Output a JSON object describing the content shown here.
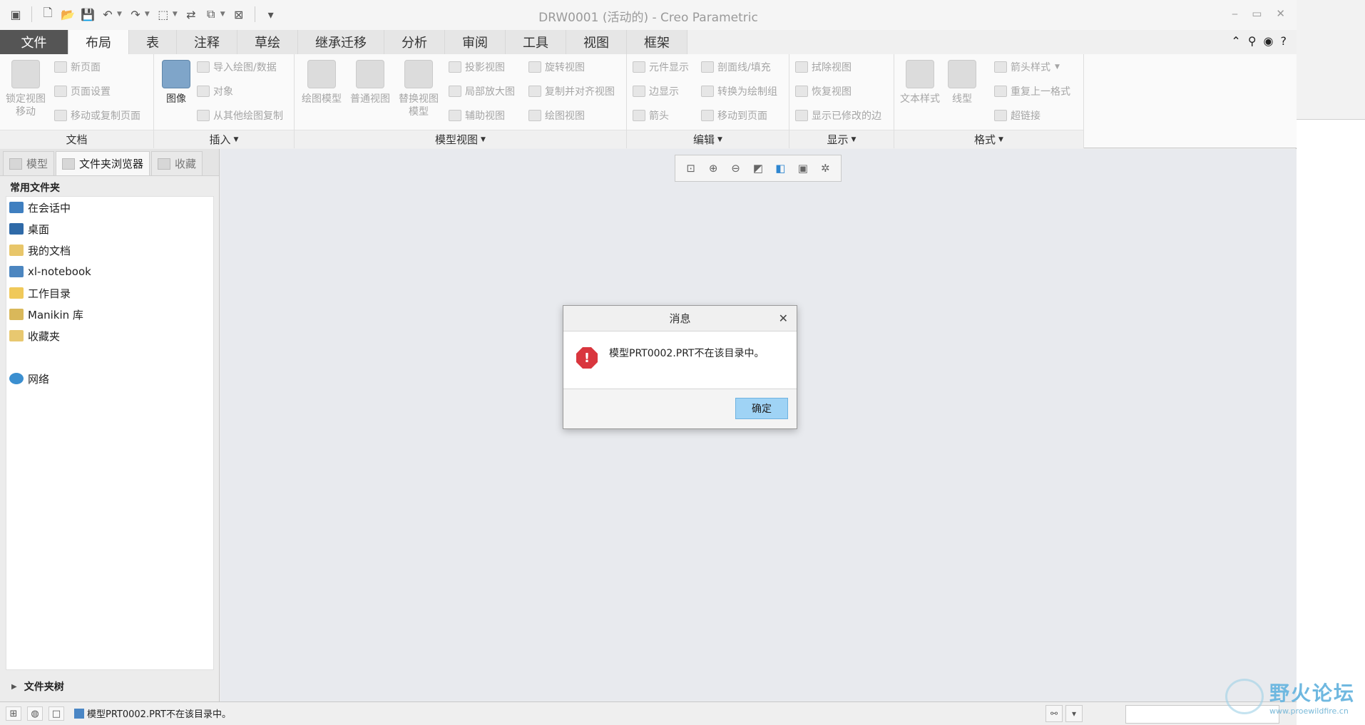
{
  "window": {
    "title": "DRW0001 (活动的) - Creo Parametric",
    "min": "⎯",
    "max": "▭",
    "close": "✕"
  },
  "menu_tabs": [
    "文件",
    "布局",
    "表",
    "注释",
    "草绘",
    "继承迁移",
    "分析",
    "审阅",
    "工具",
    "视图",
    "框架"
  ],
  "ribbon": {
    "doc": {
      "label": "文档",
      "lock_view": "锁定视图\n移动",
      "new_page": "新页面",
      "page_setup": "页面设置",
      "move_copy": "移动或复制页面"
    },
    "insert": {
      "label": "插入",
      "image": "图像",
      "import": "导入绘图/数据",
      "object": "对象",
      "copy_from": "从其他绘图复制"
    },
    "model_views": {
      "label": "模型视图",
      "drawing_model": "绘图模型",
      "general_view": "普通视图",
      "replace_view": "替换视图\n模型",
      "projection": "投影视图",
      "detailed": "局部放大图",
      "auxiliary": "辅助视图",
      "revolved": "旋转视图",
      "copy_align": "复制并对齐视图",
      "drawing_view": "绘图视图"
    },
    "edit": {
      "label": "编辑",
      "component_display": "元件显示",
      "edge_display": "边显示",
      "arrow": "箭头",
      "hatch": "剖面线/填充",
      "convert": "转换为绘制组",
      "move_to_page": "移动到页面"
    },
    "display": {
      "label": "显示",
      "erase": "拭除视图",
      "restore": "恢复视图",
      "show_modified": "显示已修改的边"
    },
    "format": {
      "label": "格式",
      "text_style": "文本样式",
      "line_style": "线型",
      "arrow_style": "箭头样式",
      "repeat_format": "重复上一格式",
      "hyperlink": "超链接"
    }
  },
  "left_panel": {
    "tabs": [
      "模型",
      "文件夹浏览器",
      "收藏"
    ],
    "fav_title": "常用文件夹",
    "items": [
      "在会话中",
      "桌面",
      "我的文档",
      "xl-notebook",
      "工作目录",
      "Manikin 库",
      "收藏夹",
      "网络"
    ],
    "folder_tree": "文件夹树"
  },
  "dialog": {
    "title": "消息",
    "message": "模型PRT0002.PRT不在该目录中。",
    "ok": "确定"
  },
  "status": {
    "message": "模型PRT0002.PRT不在该目录中。"
  },
  "watermark": {
    "cn": "野火论坛",
    "url": "www.proewildfire.cn"
  }
}
